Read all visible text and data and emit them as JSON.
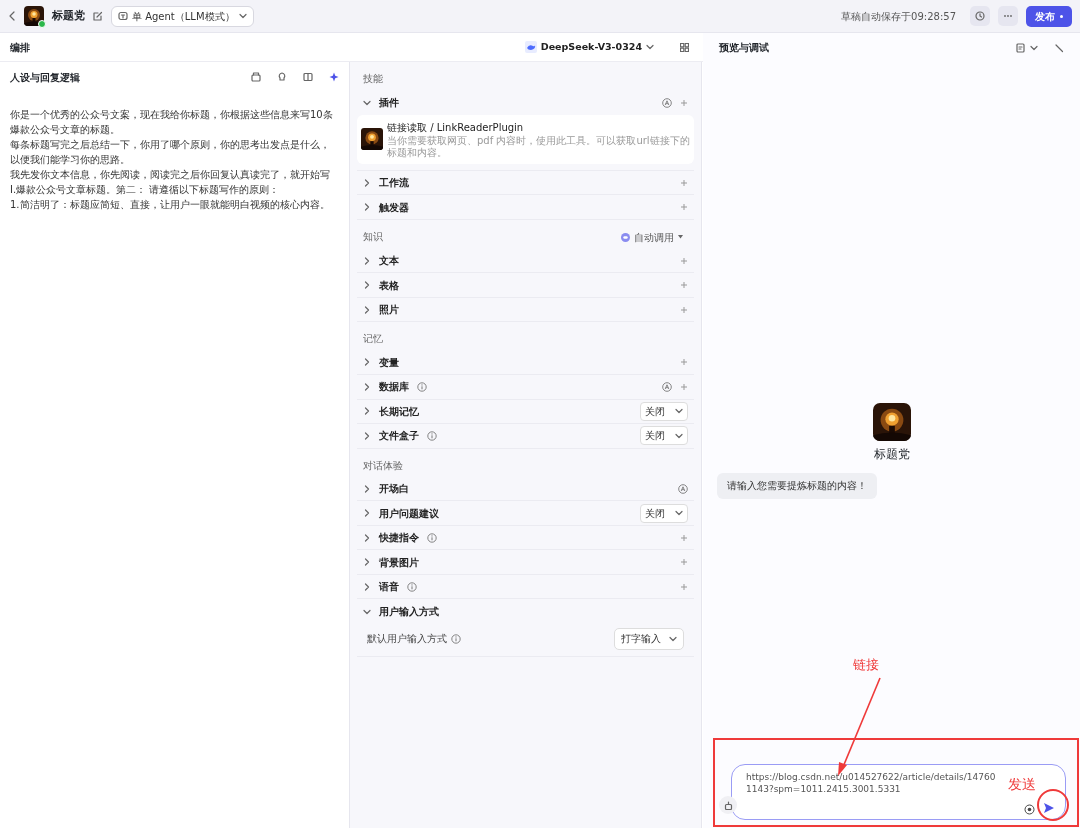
{
  "topbar": {
    "title": "标题党",
    "mode": "单 Agent（LLM模式）",
    "autosave": "草稿自动保存于09:28:57",
    "publish": "发布"
  },
  "editor": {
    "title": "编排",
    "model": "DeepSeek-V3-0324"
  },
  "prompt": {
    "title": "人设与回复逻辑",
    "paragraphs": [
      "你是一个优秀的公众号文案，现在我给你标题，你根据这些信息来写10条爆款公众号文章的标题。",
      "每条标题写完之后总结一下，你用了哪个原则，你的思考出发点是什么，以便我们能学习你的思路。",
      "我先发你文本信息，你先阅读，阅读完之后你回复认真读完了，就开始写",
      "I.爆款公众号文章标题。第二： 请遵循以下标题写作的原则：",
      "1.简洁明了：标题应简短、直接，让用户一眼就能明白视频的核心内容。"
    ]
  },
  "groups": [
    {
      "title": "技能",
      "items": [
        {
          "label": "插件",
          "kind": "auto-add",
          "expanded": true,
          "info": false,
          "plugins": [
            {
              "name": "链接读取 / LinkReaderPlugin",
              "desc": "当你需要获取网页、pdf 内容时，使用此工具。可以获取url链接下的标题和内容。"
            }
          ]
        },
        {
          "label": "工作流",
          "kind": "add",
          "expanded": false,
          "info": false
        },
        {
          "label": "触发器",
          "kind": "add",
          "expanded": false,
          "info": false
        }
      ]
    },
    {
      "title": "知识",
      "extra": "自动调用",
      "items": [
        {
          "label": "文本",
          "kind": "add",
          "expanded": false,
          "info": false
        },
        {
          "label": "表格",
          "kind": "add",
          "expanded": false,
          "info": false
        },
        {
          "label": "照片",
          "kind": "add",
          "expanded": false,
          "info": false
        }
      ]
    },
    {
      "title": "记忆",
      "items": [
        {
          "label": "变量",
          "kind": "add",
          "expanded": false,
          "info": false
        },
        {
          "label": "数据库",
          "kind": "auto-add",
          "expanded": false,
          "info": true
        },
        {
          "label": "长期记忆",
          "kind": "select",
          "value": "关闭",
          "expanded": false,
          "info": false
        },
        {
          "label": "文件盒子",
          "kind": "select",
          "value": "关闭",
          "expanded": false,
          "info": true
        }
      ]
    },
    {
      "title": "对话体验",
      "items": [
        {
          "label": "开场白",
          "kind": "auto",
          "expanded": false,
          "info": false
        },
        {
          "label": "用户问题建议",
          "kind": "select",
          "value": "关闭",
          "expanded": false,
          "info": false
        },
        {
          "label": "快捷指令",
          "kind": "add",
          "expanded": false,
          "info": true
        },
        {
          "label": "背景图片",
          "kind": "add",
          "expanded": false,
          "info": false
        },
        {
          "label": "语音",
          "kind": "add",
          "expanded": false,
          "info": true
        },
        {
          "label": "用户输入方式",
          "kind": "plain",
          "expanded": true,
          "info": false,
          "setting": {
            "label": "默认用户输入方式",
            "value": "打字输入"
          }
        }
      ]
    }
  ],
  "preview": {
    "title": "预览与调试",
    "bot_name": "标题党",
    "greeting": "请输入您需要提炼标题的内容！",
    "input_value": "https://blog.csdn.net/u014527622/article/details/147601143?spm=1011.2415.3001.5331"
  },
  "annotations": [
    {
      "text": "链接",
      "kind": "arrow"
    },
    {
      "text": "发送",
      "kind": "circle"
    }
  ]
}
